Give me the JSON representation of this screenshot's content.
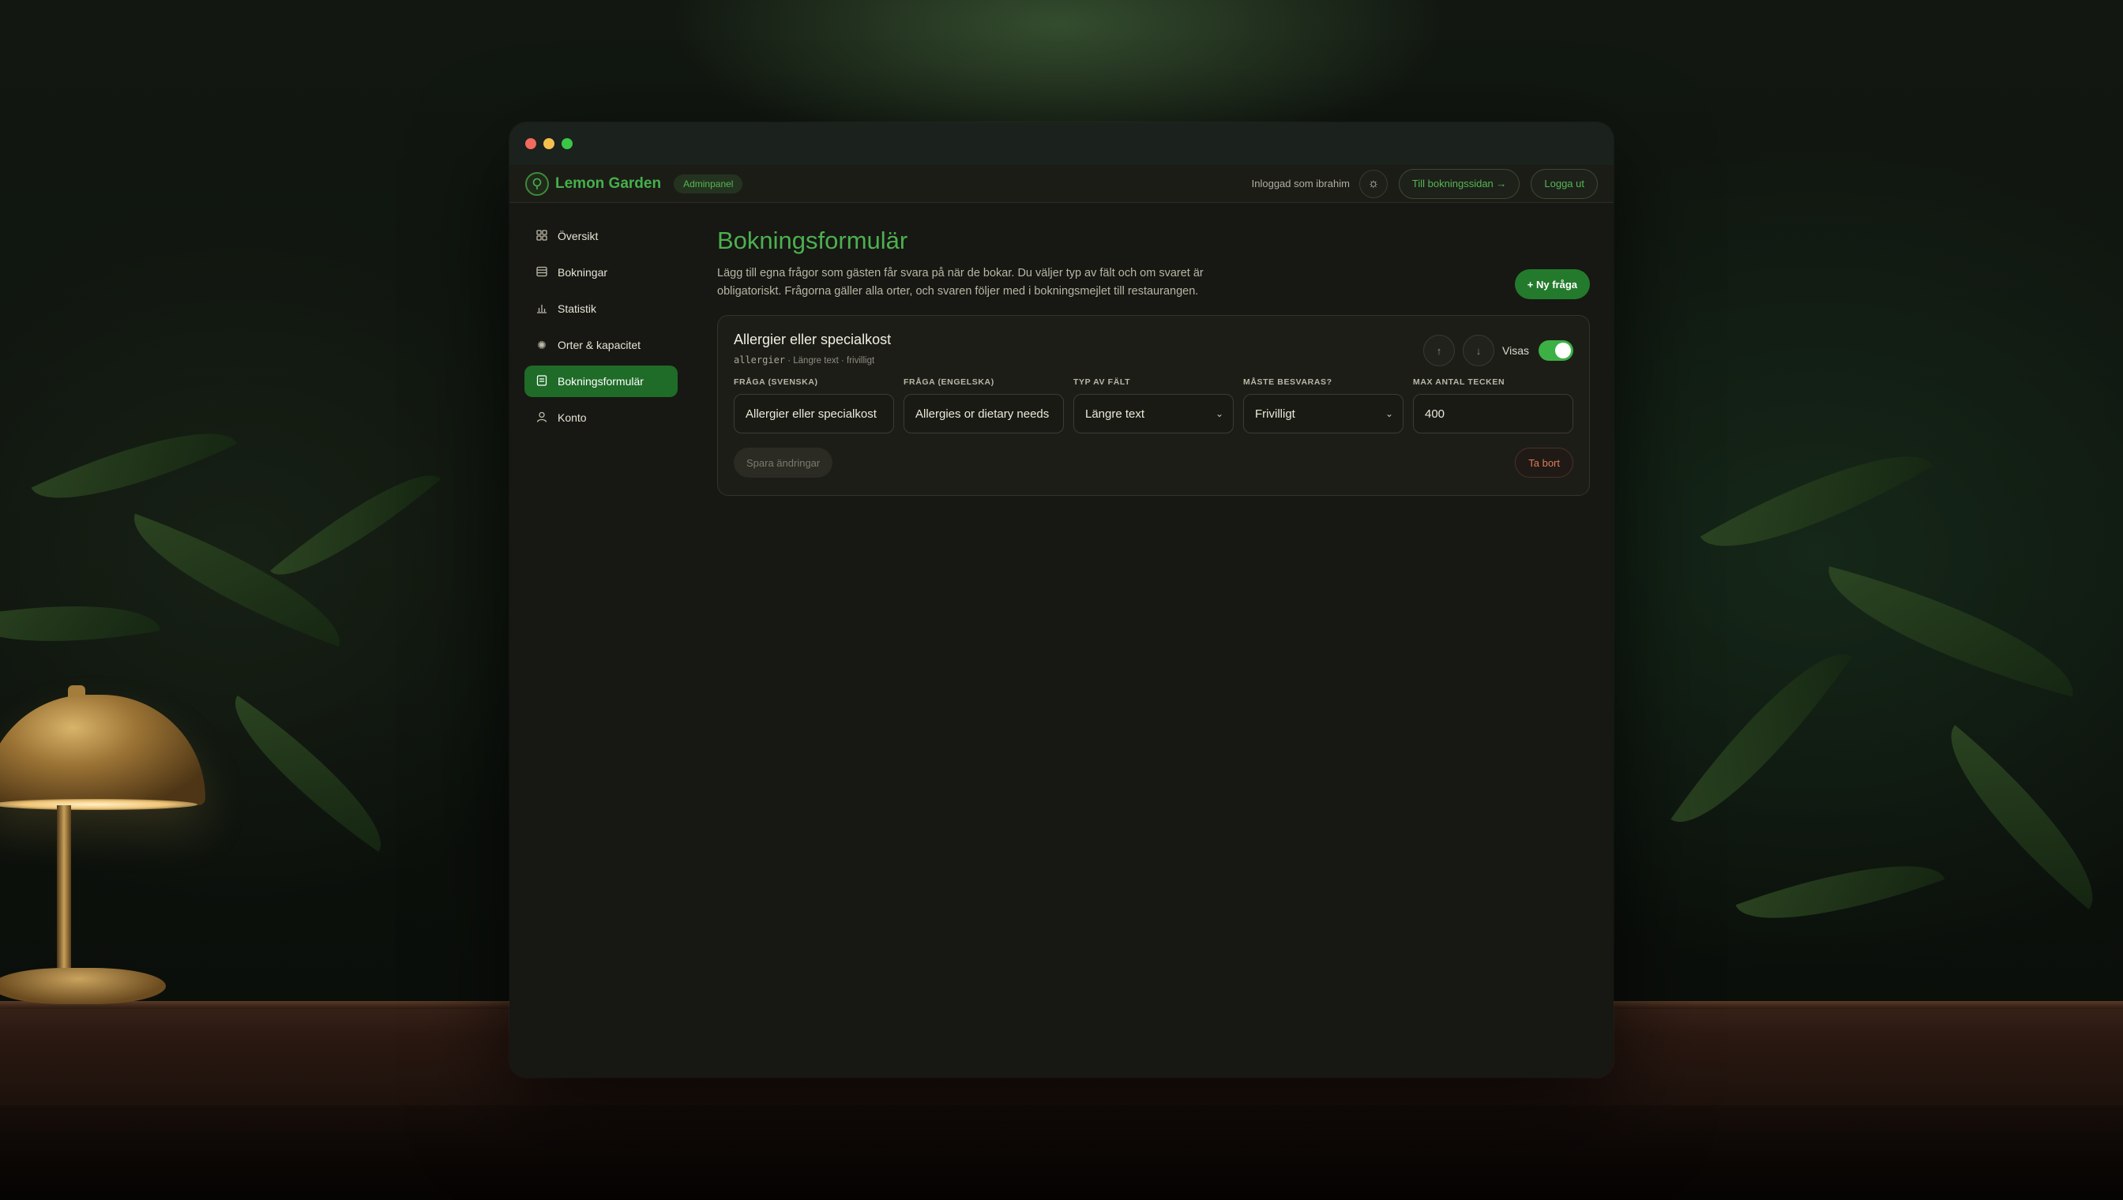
{
  "window": {
    "title_dots": [
      "close",
      "minimize",
      "maximize"
    ]
  },
  "header": {
    "logo_icon": "lemon-tree-icon",
    "brand": "Lemon Garden",
    "badge": "Adminpanel",
    "logged_in_text": "Inloggad som ibrahim",
    "theme_icon": "sun-icon",
    "booking_site_button": "Till bokningssidan →",
    "logout_button": "Logga ut"
  },
  "sidebar": {
    "items": [
      {
        "label": "Översikt",
        "icon": "grid-icon",
        "active": false
      },
      {
        "label": "Bokningar",
        "icon": "list-icon",
        "active": false
      },
      {
        "label": "Statistik",
        "icon": "bar-chart-icon",
        "active": false
      },
      {
        "label": "Orter & kapacitet",
        "icon": "gear-icon",
        "active": false
      },
      {
        "label": "Bokningsformulär",
        "icon": "form-icon",
        "active": true
      },
      {
        "label": "Konto",
        "icon": "user-icon",
        "active": false
      }
    ]
  },
  "main": {
    "title": "Bokningsformulär",
    "description": "Lägg till egna frågor som gästen får svara på när de bokar. Du väljer typ av fält och om svaret är obligatoriskt. Frågorna gäller alla orter, och svaren följer med i bokningsmejlet till restaurangen.",
    "new_question_button": "+ Ny fråga"
  },
  "question_card": {
    "title": "Allergier eller specialkost",
    "key": "allergier",
    "meta": "· Längre text · frivilligt",
    "move_up": "↑",
    "move_down": "↓",
    "visible_label": "Visas",
    "visible": true,
    "fields": {
      "sv_label": "FRÅGA (SVENSKA)",
      "sv_value": "Allergier eller specialkost",
      "en_label": "FRÅGA (ENGELSKA)",
      "en_value": "Allergies or dietary needs",
      "type_label": "TYP AV FÄLT",
      "type_value": "Längre text",
      "required_label": "MÅSTE BESVARAS?",
      "required_value": "Frivilligt",
      "max_label": "MAX ANTAL TECKEN",
      "max_value": "400"
    },
    "save_button": "Spara ändringar",
    "delete_button": "Ta bort"
  },
  "colors": {
    "accent": "#4cb04f",
    "active_nav": "#1f6b28",
    "danger": "#e07a58",
    "window_bg": "#171713"
  }
}
